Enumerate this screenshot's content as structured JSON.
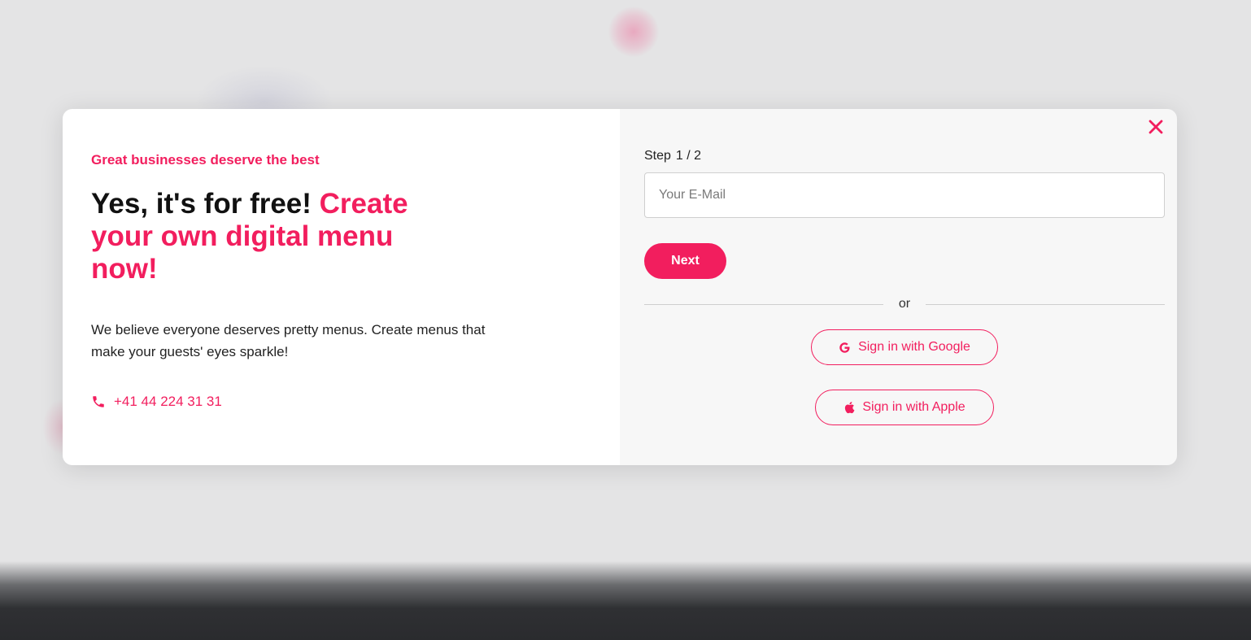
{
  "colors": {
    "accent": "#f21e5e",
    "backdrop": "#e4e4e5",
    "left_panel": "#ffffff",
    "right_panel": "#f7f7f7"
  },
  "intro": {
    "eyebrow": "Great businesses deserve the best",
    "headline_plain": "Yes, it's for free! ",
    "headline_accent": "Create your own digital menu now!",
    "body": "We believe everyone deserves pretty menus. Create menus that make your guests' eyes sparkle!",
    "phone": "+41 44 224 31 31",
    "phone_icon": "phone-icon"
  },
  "form": {
    "close_icon": "close-icon",
    "step_label": "Step",
    "step_value": "1 / 2",
    "email_placeholder": "Your E-Mail",
    "email_value": "",
    "next_label": "Next",
    "divider_text": "or",
    "google_label": "Sign in with Google",
    "google_icon": "google-icon",
    "apple_label": "Sign in with Apple",
    "apple_icon": "apple-icon"
  }
}
